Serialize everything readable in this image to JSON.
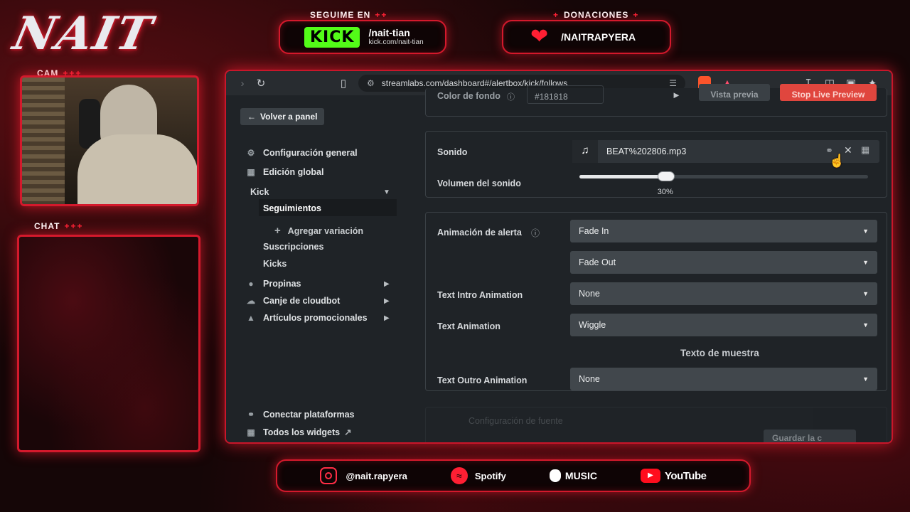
{
  "overlay": {
    "logo": "NAIT",
    "follow_title": "SEGUIME EN",
    "donations_title": "DONACIONES",
    "plus_marks": "++",
    "cam_label": "CAM",
    "chat_label": "CHAT",
    "cam_plus": "+++",
    "kick_logo": "KICK",
    "kick_handle": "/nait-tian",
    "kick_url": "kick.com/nait-tian",
    "donation_handle": "/NAITRAPYERA",
    "socials": {
      "instagram": "@nait.rapyera",
      "spotify": "Spotify",
      "music": "MUSIC",
      "youtube": "YouTube"
    }
  },
  "browser": {
    "url": "streamlabs.com/dashboard#/alertbox/kick/follows"
  },
  "sidebar": {
    "back": "Volver a panel",
    "items": [
      {
        "label": "Configuración general",
        "icon": "gear-icon"
      },
      {
        "label": "Edición global",
        "icon": "grid-icon"
      }
    ],
    "kick": "Kick",
    "sub": {
      "follows": "Seguimientos",
      "add_variation": "Agregar variación",
      "subs": "Suscripciones",
      "kicks": "Kicks"
    },
    "more": [
      {
        "label": "Propinas",
        "icon": "tip-icon"
      },
      {
        "label": "Canje de cloudbot",
        "icon": "cloud-icon"
      },
      {
        "label": "Artículos promocionales",
        "icon": "shirt-icon"
      }
    ],
    "bottom": {
      "connect": "Conectar plataformas",
      "widgets": "Todos los widgets"
    }
  },
  "main": {
    "bg_color_label": "Color de fondo",
    "bg_color_value": "#181818",
    "preview_btn": "Vista previa",
    "stop_preview_btn": "Stop Live Preview",
    "sound_label": "Sonido",
    "sound_file": "BEAT%202806.mp3",
    "volume_label": "Volumen del sonido",
    "volume_value": "30%",
    "volume_fraction": 0.3,
    "alert_anim_label": "Animación de alerta",
    "anim_in": "Fade In",
    "anim_out": "Fade Out",
    "text_intro_label": "Text Intro Animation",
    "text_intro_value": "None",
    "text_anim_label": "Text Animation",
    "text_anim_value": "Wiggle",
    "sample_text": "Texto de muestra",
    "text_outro_label": "Text Outro Animation",
    "text_outro_value": "None",
    "font_section": "Configuración de fuente",
    "save_btn": "Guardar la c"
  },
  "colors": {
    "accent_red": "#d4192c",
    "stop_button": "#e0463e",
    "kick_green": "#53fc18"
  }
}
